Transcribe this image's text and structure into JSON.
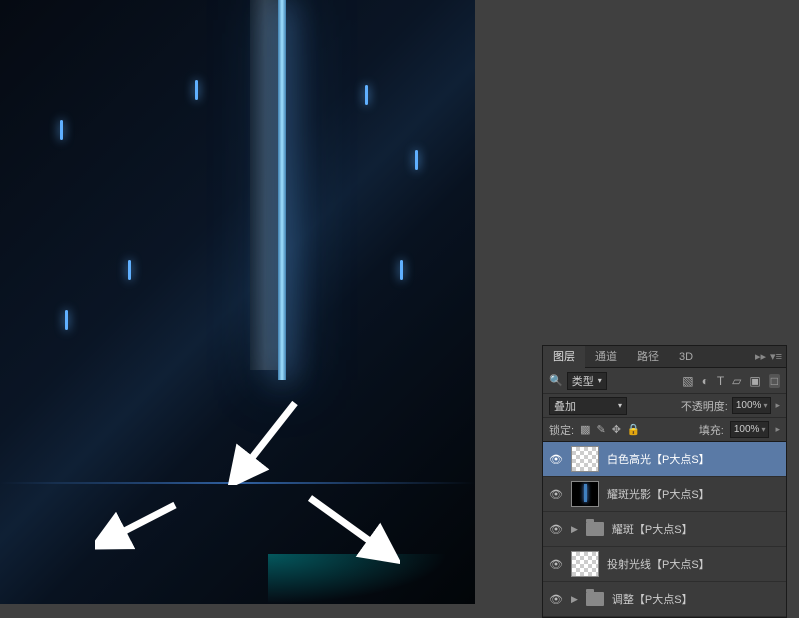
{
  "tabs": {
    "layers": "图层",
    "channels": "通道",
    "paths": "路径",
    "threed": "3D"
  },
  "filter": {
    "label": "类型"
  },
  "blend": {
    "mode": "叠加",
    "opacity_label": "不透明度:",
    "opacity_value": "100%"
  },
  "lock": {
    "label": "锁定:",
    "fill_label": "填充:",
    "fill_value": "100%"
  },
  "layers": [
    {
      "name": "白色高光【P大点S】",
      "thumb": "trans",
      "selected": true
    },
    {
      "name": "耀斑光影【P大点S】",
      "thumb": "dark",
      "selected": false
    },
    {
      "name": "耀斑【P大点S】",
      "thumb": "folder",
      "selected": false
    },
    {
      "name": "投射光线【P大点S】",
      "thumb": "trans",
      "selected": false
    },
    {
      "name": "调整【P大点S】",
      "thumb": "folder",
      "selected": false
    }
  ]
}
